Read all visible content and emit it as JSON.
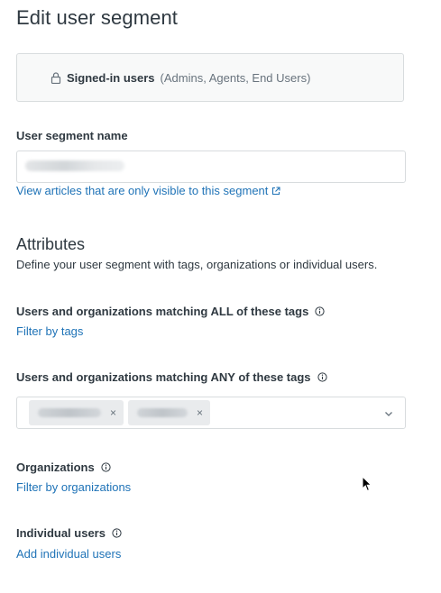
{
  "header": {
    "title": "Edit user segment"
  },
  "segment": {
    "name": "Signed-in users",
    "roles": "(Admins, Agents, End Users)"
  },
  "form": {
    "name_label": "User segment name",
    "name_value": "",
    "view_articles_link": "View articles that are only visible to this segment"
  },
  "attributes": {
    "title": "Attributes",
    "description": "Define your user segment with tags, organizations or individual users.",
    "all_tags_label": "Users and organizations matching ALL of these tags",
    "all_tags_link": "Filter by tags",
    "any_tags_label": "Users and organizations matching ANY of these tags",
    "any_tags_remove_1": "×",
    "any_tags_remove_2": "×",
    "organizations_label": "Organizations",
    "organizations_link": "Filter by organizations",
    "individual_label": "Individual users",
    "individual_link": "Add individual users"
  },
  "icons": {
    "segment_icon": "lock-icon",
    "info_icon": "info-icon",
    "external_icon": "external-link-icon",
    "dropdown_icon": "chevron-down-icon",
    "pointer": "cursor-icon"
  },
  "colors": {
    "link": "#1f73b7",
    "text": "#2f3941",
    "muted": "#68737d",
    "border": "#d8dcde",
    "box_bg": "#f8f9f9",
    "tag_bg": "#e9ebed"
  }
}
